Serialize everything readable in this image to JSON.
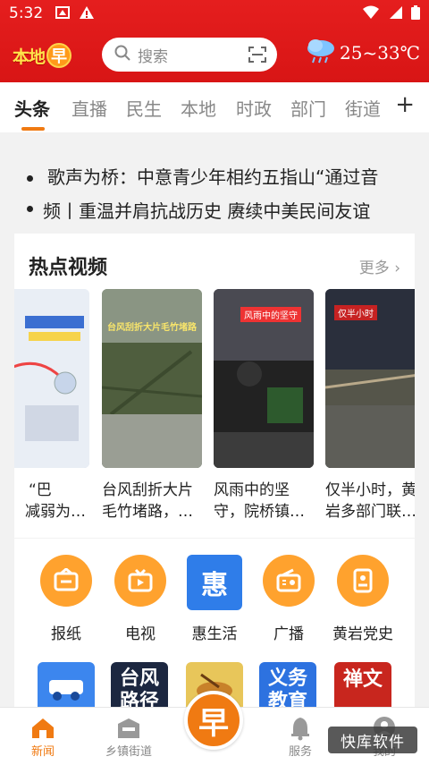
{
  "status_bar": {
    "time": "5:32"
  },
  "header": {
    "logo_text": "本地",
    "logo_badge": "早",
    "search_placeholder": "搜索",
    "weather_temp": "25~33℃"
  },
  "tabs": [
    "头条",
    "直播",
    "民生",
    "本地",
    "时政",
    "部门",
    "街道"
  ],
  "tab_plus": "+",
  "ticker": [
    "歌声为桥：中意青少年相约五指山“通过音",
    "频丨重温并肩抗战历史 赓续中美民间友谊"
  ],
  "hot_videos": {
    "title": "热点视频",
    "more": "更多",
    "items": [
      {
        "title": "“巴…台风减弱为…",
        "line1": "“巴",
        "line2": "减弱为…",
        "thumb_caption": ""
      },
      {
        "title": "台风刮折大片毛竹堵路，…",
        "line1": "台风刮折大片",
        "line2": "毛竹堵路，…",
        "thumb_caption": "台风刮折大片毛竹堵路"
      },
      {
        "title": "风雨中的坚守，院桥镇…",
        "line1": "风雨中的坚",
        "line2": "守，院桥镇…",
        "thumb_caption": "风雨中的坚守"
      },
      {
        "title": "仅半小时，黄岩多部门联…",
        "line1": "仅半小时，黄",
        "line2": "岩多部门联…",
        "thumb_caption": "仅半小时"
      }
    ]
  },
  "services": [
    {
      "label": "报纸",
      "icon": "newspaper-icon"
    },
    {
      "label": "电视",
      "icon": "tv-icon"
    },
    {
      "label": "惠生活",
      "icon": "hui-icon",
      "glyph": "惠"
    },
    {
      "label": "广播",
      "icon": "radio-icon"
    },
    {
      "label": "黄岩党史",
      "icon": "book-icon"
    }
  ],
  "tiles": [
    {
      "text": "",
      "color": "#2f7de9"
    },
    {
      "text": "台风路径",
      "color": "#1c2740"
    },
    {
      "text": "",
      "color": "#e8c65a"
    },
    {
      "text": "义务教育",
      "color": "#2d72e0"
    },
    {
      "text": "禅文",
      "color": "#c8261e"
    }
  ],
  "bottom_nav": [
    {
      "label": "新闻",
      "icon": "home-icon"
    },
    {
      "label": "乡镇街道",
      "icon": "street-icon"
    },
    {
      "label": "早",
      "icon": "center-icon"
    },
    {
      "label": "服务",
      "icon": "bell-icon"
    },
    {
      "label": "我的",
      "icon": "user-icon"
    }
  ],
  "watermark": "快库软件",
  "colors": {
    "brand_red": "#d81515",
    "accent_orange": "#f07a12",
    "service_blue": "#2f7de9"
  }
}
